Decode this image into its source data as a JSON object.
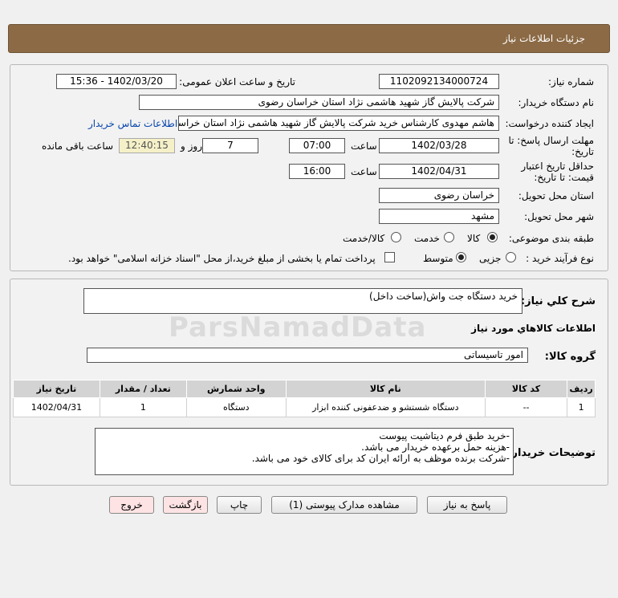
{
  "header": {
    "title": "جزئیات اطلاعات نیاز"
  },
  "fields": {
    "need_number": {
      "label": "شماره نیاز:",
      "value": "1102092134000724"
    },
    "announce_datetime": {
      "label": "تاریخ و ساعت اعلان عمومی:",
      "value": "1402/03/20 - 15:36"
    },
    "buyer_org": {
      "label": "نام دستگاه خریدار:",
      "value": "شرکت پالایش گاز شهید هاشمی نژاد   استان خراسان رضوی"
    },
    "requester": {
      "label": "ایجاد کننده درخواست:",
      "value": "هاشم مهدوی کارشناس خرید شرکت پالایش گاز شهید هاشمی نژاد   استان خراسان",
      "contact_link": "اطلاعات تماس خریدار"
    },
    "reply_deadline": {
      "label_line1": "مهلت ارسال پاسخ: تا",
      "label_line2": "تاریخ:",
      "date": "1402/03/28",
      "time_label": "ساعت",
      "time": "07:00",
      "days": "7",
      "days_label": "روز و",
      "remaining": "12:40:15",
      "remaining_label": "ساعت باقی مانده"
    },
    "price_validity": {
      "label_line1": "حداقل تاریخ اعتبار",
      "label_line2": "قیمت: تا تاریخ:",
      "date": "1402/04/31",
      "time_label": "ساعت",
      "time": "16:00"
    },
    "delivery_province": {
      "label": "استان محل تحویل:",
      "value": "خراسان رضوی"
    },
    "delivery_city": {
      "label": "شهر محل تحویل:",
      "value": "مشهد"
    },
    "category": {
      "label": "طبقه بندی موضوعی:",
      "options": [
        "کالا",
        "خدمت",
        "کالا/خدمت"
      ],
      "selected": "کالا"
    },
    "purchase_process": {
      "label": "نوع فرآیند خرید :",
      "options": [
        "جزیی",
        "متوسط"
      ],
      "selected": "متوسط",
      "treasury_note": "پرداخت تمام یا بخشی از مبلغ خرید،از محل \"اسناد خزانه اسلامی\" خواهد بود."
    }
  },
  "summary": {
    "label": "شرح کلي نياز:",
    "value": "خرید دستگاه جت واش(ساخت داخل)"
  },
  "goods_section": {
    "title": "اطلاعات کالاهاي مورد نياز",
    "group_label": "گروه کالا:",
    "group_value": "امور تاسیساتی",
    "columns": [
      "ردیف",
      "کد کالا",
      "نام کالا",
      "واحد شمارش",
      "تعداد / مقدار",
      "تاریخ نیاز"
    ],
    "rows": [
      [
        "1",
        "--",
        "دستگاه شستشو و ضدعفونی کننده ابزار",
        "دستگاه",
        "1",
        "1402/04/31"
      ]
    ]
  },
  "buyer_notes": {
    "label": "توضیحات خریدار:",
    "lines": [
      "-خرید طبق فرم دیتاشیت پیوست",
      "-هزینه حمل برعهده خریدار می باشد.",
      "-شرکت برنده موظف به ارائه ایران کد برای کالای خود می باشد."
    ]
  },
  "buttons": {
    "reply": "پاسخ به نیاز",
    "attachments": "مشاهده مدارک پیوستی (1)",
    "print": "چاپ",
    "back": "بازگشت",
    "exit": "خروج"
  },
  "colors": {
    "header_bg": "#8b6a45",
    "link": "#0645ad"
  }
}
